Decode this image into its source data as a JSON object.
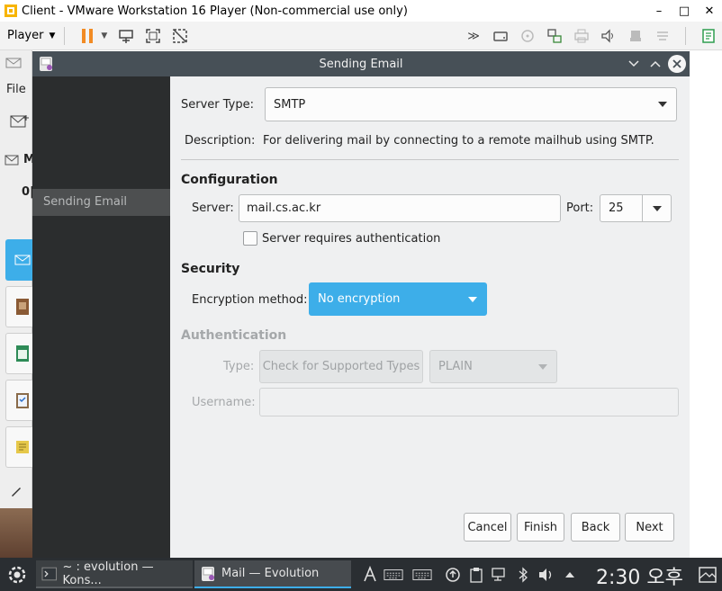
{
  "vmware": {
    "title": "Client - VMware Workstation 16 Player (Non-commercial use only)",
    "player_menu": "Player",
    "controls": {
      "minimize": "–",
      "maximize": "□",
      "close": "✕"
    }
  },
  "background_app": {
    "file_menu": "File",
    "m_label": "M",
    "zero_label": "0|"
  },
  "dialog": {
    "title": "Sending Email",
    "sidebar_item": "Sending Email",
    "server_type_label": "Server Type:",
    "server_type_value": "SMTP",
    "description_label": "Description:",
    "description_text": "For delivering mail by connecting to a remote mailhub using SMTP.",
    "configuration_title": "Configuration",
    "server_label": "Server:",
    "server_value": "mail.cs.ac.kr",
    "port_label": "Port:",
    "port_value": "25",
    "requires_auth_label": "Server requires authentication",
    "security_title": "Security",
    "encryption_label": "Encryption method:",
    "encryption_value": "No encryption",
    "authentication_title": "Authentication",
    "type_label": "Type:",
    "check_types_button": "Check for Supported Types",
    "auth_type_value": "PLAIN",
    "username_label": "Username:",
    "username_value": "",
    "buttons": {
      "cancel": "Cancel",
      "finish": "Finish",
      "back": "Back",
      "next": "Next"
    }
  },
  "taskbar": {
    "konsole_label": "~ : evolution — Kons...",
    "evolution_label": "Mail — Evolution",
    "clock": "2:30 오후"
  },
  "colors": {
    "accent": "#3daee9",
    "dialog_bg": "#eff0f1",
    "titlebar": "#475057",
    "sidebar": "#2b2d2e",
    "taskbar": "#2a2e32"
  }
}
